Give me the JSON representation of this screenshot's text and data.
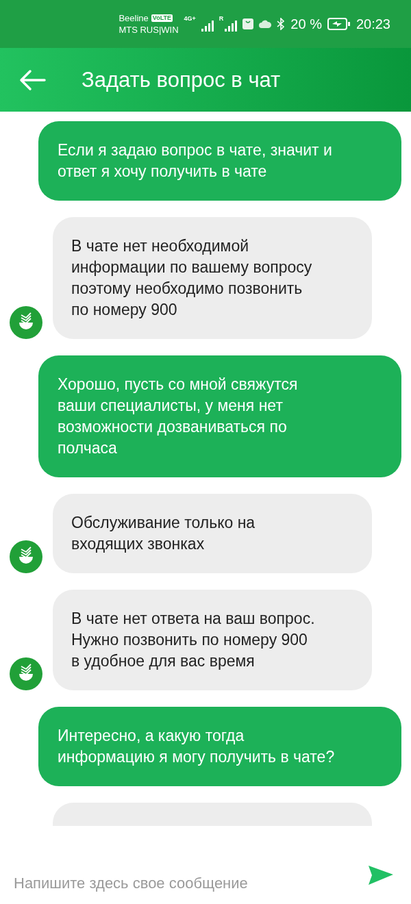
{
  "status_bar": {
    "carrier_1": "Beeline",
    "volte_badge": "VoLTE",
    "carrier_2": "MTS RUS|WIN",
    "network_1": "4G+",
    "roaming": "R",
    "battery_percent": "20 %",
    "time": "20:23"
  },
  "header": {
    "title": "Задать вопрос в чат"
  },
  "messages": [
    {
      "kind": "outgoing",
      "text": "Если я задаю вопрос в чате, значит и\nответ я хочу получить в чате"
    },
    {
      "kind": "incoming",
      "text": "В чате нет необходимой\nинформации по вашему вопросу\nпоэтому необходимо позвонить\nпо номеру 900"
    },
    {
      "kind": "outgoing",
      "text": "Хорошо, пусть со мной свяжутся\nваши специалисты, у меня нет\nвозможности дозваниваться по\nполчаса"
    },
    {
      "kind": "incoming",
      "text": "Обслуживание только на\nвходящих звонках"
    },
    {
      "kind": "incoming",
      "text": "В чате нет ответа на ваш вопрос.\nНужно позвонить по номеру 900\nв удобное для вас время"
    },
    {
      "kind": "outgoing",
      "text": "Интересно, а какую тогда\nинформацию я могу получить в чате?"
    },
    {
      "kind": "partial"
    }
  ],
  "composer": {
    "placeholder": "Напишите здесь свое сообщение"
  }
}
